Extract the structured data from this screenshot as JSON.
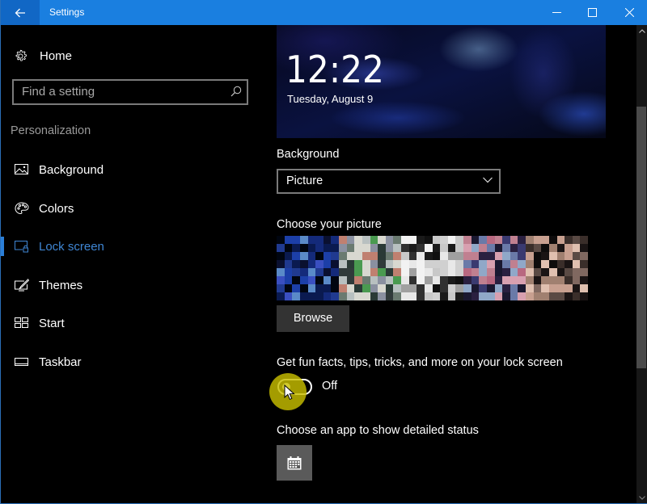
{
  "window": {
    "title": "Settings",
    "controls": [
      "minimize",
      "maximize",
      "close"
    ],
    "accent_color": "#1a7fe0"
  },
  "sidebar": {
    "home_label": "Home",
    "search_placeholder": "Find a setting",
    "section_title": "Personalization",
    "items": [
      {
        "label": "Background",
        "icon": "picture-icon",
        "active": false
      },
      {
        "label": "Colors",
        "icon": "palette-icon",
        "active": false
      },
      {
        "label": "Lock screen",
        "icon": "lock-screen-icon",
        "active": true
      },
      {
        "label": "Themes",
        "icon": "themes-icon",
        "active": false
      },
      {
        "label": "Start",
        "icon": "start-icon",
        "active": false
      },
      {
        "label": "Taskbar",
        "icon": "taskbar-icon",
        "active": false
      }
    ],
    "active_color": "#3f86d4"
  },
  "preview": {
    "time": "12:22",
    "date": "Tuesday, August 9"
  },
  "background_setting": {
    "label": "Background",
    "selected": "Picture"
  },
  "choose_picture": {
    "label": "Choose your picture",
    "thumbnail_count": 5,
    "thumbnails": [
      {
        "palette": [
          "#0a1030",
          "#142a7a",
          "#1c3fa8",
          "#3a4fc0",
          "#5a8ac8",
          "#0a1a50",
          "#203a90",
          "#000510"
        ]
      },
      {
        "palette": [
          "#2a3a36",
          "#d8d8d0",
          "#b8c0c0",
          "#6a7a70",
          "#4a9a50",
          "#c08070",
          "#8a90a0",
          "#303a3a"
        ]
      },
      {
        "palette": [
          "#101010",
          "#e8e8e8",
          "#d0d0d0",
          "#f2f2f2",
          "#a0a0a0",
          "#303030",
          "#c8c8c8",
          "#1a1a1a"
        ]
      },
      {
        "palette": [
          "#2a2040",
          "#c08090",
          "#90a8c8",
          "#3a3a70",
          "#d8a0b0",
          "#6a7aa8",
          "#b86880",
          "#1a1830"
        ]
      },
      {
        "palette": [
          "#1a1414",
          "#e0c0b0",
          "#806860",
          "#3a2e2a",
          "#c8a090",
          "#0e0c0c",
          "#5a4a44",
          "#a08070"
        ]
      }
    ],
    "browse_label": "Browse"
  },
  "fun_facts": {
    "label": "Get fun facts, tips, tricks, and more on your lock screen",
    "toggle_state": "Off",
    "enabled": false
  },
  "detailed_status": {
    "label": "Choose an app to show detailed status",
    "app_icon": "calendar-icon"
  }
}
